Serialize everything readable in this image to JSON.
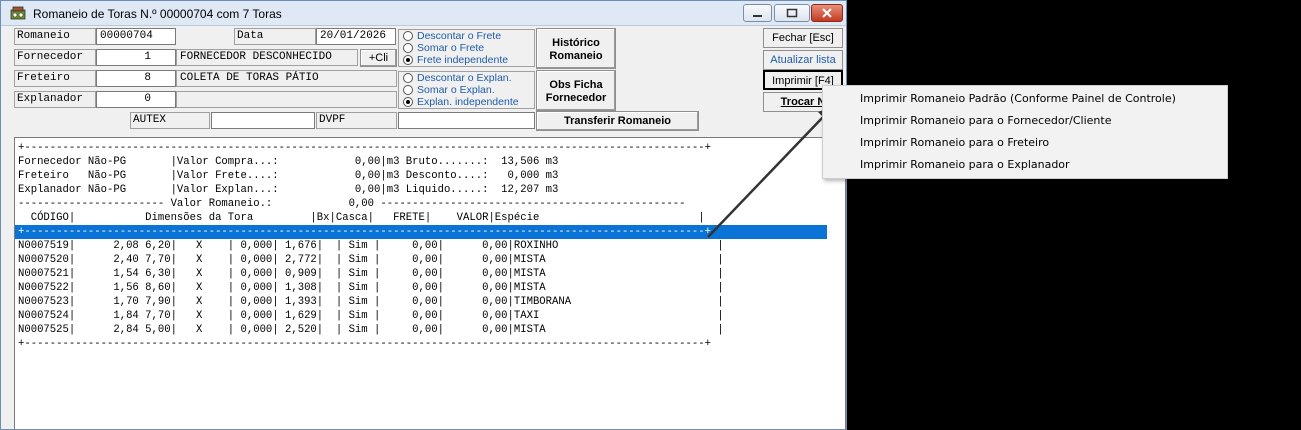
{
  "window": {
    "title": "Romaneio de Toras  N.º 00000704 com 7 Toras"
  },
  "form": {
    "romaneio_label": "Romaneio",
    "romaneio_value": "00000704",
    "data_label": "Data",
    "data_value": "20/01/2026",
    "fornecedor_label": "Fornecedor",
    "fornecedor_code": "1",
    "fornecedor_name": "FORNECEDOR DESCONHECIDO",
    "add_client_label": "+Cli",
    "freteiro_label": "Freteiro",
    "freteiro_code": "8",
    "freteiro_name": "COLETA DE TORAS PÁTIO",
    "explanador_label": "Explanador",
    "explanador_code": "0",
    "explanador_name": "",
    "autex_label": "AUTEX",
    "autex_value": "",
    "dvpf_label": "DVPF",
    "dvpf_value": ""
  },
  "frete_options": [
    {
      "label": "Descontar o Frete",
      "selected": false
    },
    {
      "label": "Somar o Frete",
      "selected": false
    },
    {
      "label": "Frete independente",
      "selected": true
    }
  ],
  "explan_options": [
    {
      "label": "Descontar o Explan.",
      "selected": false
    },
    {
      "label": "Somar o Explan.",
      "selected": false
    },
    {
      "label": "Explan. independente",
      "selected": true
    }
  ],
  "buttons": {
    "historico_line1": "Histórico",
    "historico_line2": "Romaneio",
    "obs_line1": "Obs Ficha",
    "obs_line2": "Fornecedor",
    "transferir": "Transferir Romaneio",
    "fechar": "Fechar [Esc]",
    "atualizar": "Atualizar lista",
    "imprimir": "Imprimir [F4]",
    "trocar": "Trocar N"
  },
  "report_lines": [
    "+-----------------------------------------------------------------------------------------------------------+",
    "Fornecedor Não-PG       |Valor Compra...:            0,00|m3 Bruto.......:  13,506 m3",
    "Freteiro   Não-PG       |Valor Frete....:            0,00|m3 Desconto....:   0,000 m3",
    "Explanador Não-PG       |Valor Explan...:            0,00|m3 Liquido.....:  12,207 m3",
    "----------------------- Valor Romaneio.:            0,00 ------------------------------------------------",
    "  CÓDIGO|           Dimensões da Tora         |Bx|Casca|   FRETE|    VALOR|Espécie                         |",
    "+-----------------------------------------------------------------------------------------------------------+",
    "N0007519|      2,08 6,20|   X    | 0,000| 1,676|  | Sim |     0,00|      0,00|ROXINHO                         |",
    "N0007520|      2,40 7,70|   X    | 0,000| 2,772|  | Sim |     0,00|      0,00|MISTA                           |",
    "N0007521|      1,54 6,30|   X    | 0,000| 0,909|  | Sim |     0,00|      0,00|MISTA                           |",
    "N0007522|      1,56 8,60|   X    | 0,000| 1,308|  | Sim |     0,00|      0,00|MISTA                           |",
    "N0007523|      1,70 7,90|   X    | 0,000| 1,393|  | Sim |     0,00|      0,00|TIMBORANA                       |",
    "N0007524|      1,84 7,70|   X    | 0,000| 1,629|  | Sim |     0,00|      0,00|TAXI                            |",
    "N0007525|      2,84 5,00|   X    | 0,000| 2,520|  | Sim |     0,00|      0,00|MISTA                           |",
    "+-----------------------------------------------------------------------------------------------------------+"
  ],
  "print_menu": [
    "Imprimir Romaneio Padrão (Conforme Painel de Controle)",
    "Imprimir Romaneio para o Fornecedor/Cliente",
    "Imprimir Romaneio para o Freteiro",
    "Imprimir Romaneio para o Explanador"
  ],
  "colors": {
    "selection": "#0a74d6",
    "link": "#1f5ca8",
    "close": "#c23b22"
  }
}
